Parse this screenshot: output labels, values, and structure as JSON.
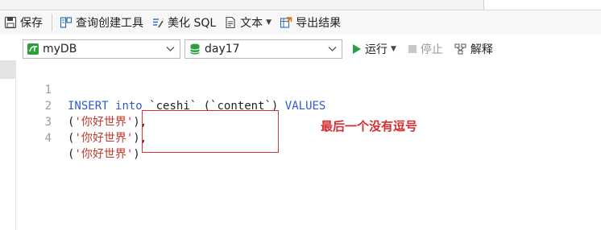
{
  "toolbar": {
    "save_label": "保存",
    "query_builder_label": "查询创建工具",
    "beautify_label": "美化 SQL",
    "text_label": "文本",
    "export_label": "导出结果"
  },
  "connection": {
    "selected": "myDB"
  },
  "database": {
    "selected": "day17"
  },
  "actions": {
    "run_label": "运行",
    "stop_label": "停止",
    "explain_label": "解释"
  },
  "editor": {
    "lines": [
      {
        "number": "1",
        "tokens": [
          "INSERT",
          " ",
          "into",
          " ",
          "`ceshi`",
          " ",
          "(`content`)",
          " ",
          "VALUES"
        ]
      },
      {
        "number": "2",
        "tokens": [
          "(",
          "'你好世界'",
          "),"
        ]
      },
      {
        "number": "3",
        "tokens": [
          "(",
          "'你好世界'",
          "),"
        ]
      },
      {
        "number": "4",
        "tokens": [
          "(",
          "'你好世界'",
          ")"
        ]
      }
    ]
  },
  "annotation": {
    "text": "最后一个没有逗号"
  },
  "colors": {
    "keyword": "#2f5bd0",
    "string": "#c0392b",
    "annotation": "#d42e2e",
    "run_icon": "#2f9e44",
    "db_icon": "#2e9e3c"
  }
}
